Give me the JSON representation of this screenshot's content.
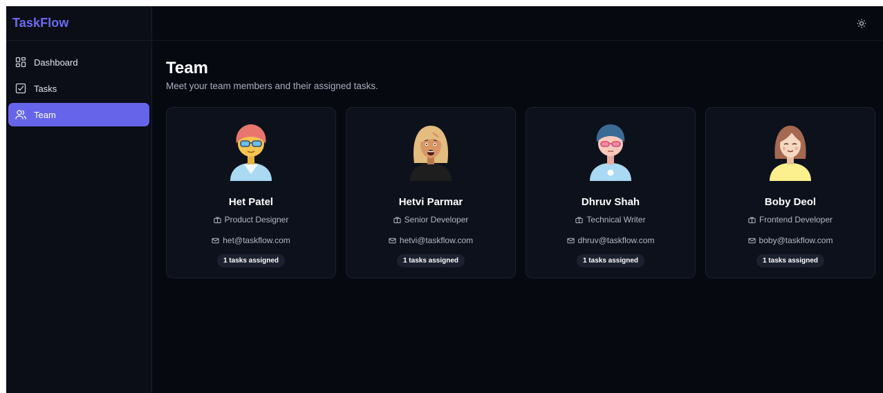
{
  "app": {
    "brand": "TaskFlow",
    "accent": "#6665e9"
  },
  "sidebar": {
    "items": [
      {
        "label": "Dashboard",
        "icon": "layout-grid-icon",
        "active": false
      },
      {
        "label": "Tasks",
        "icon": "check-square-icon",
        "active": false
      },
      {
        "label": "Team",
        "icon": "users-icon",
        "active": true
      }
    ]
  },
  "header": {
    "theme_toggle_icon": "sun-icon"
  },
  "page": {
    "title": "Team",
    "subtitle": "Meet your team members and their assigned tasks."
  },
  "members": [
    {
      "name": "Het Patel",
      "role": "Product Designer",
      "email": "het@taskflow.com",
      "tasks": "1 tasks assigned",
      "avatar": {
        "hair": "#e8766e",
        "skin": "#f5c451",
        "shirt": "#a9d9f3",
        "accessory": "sunglasses"
      }
    },
    {
      "name": "Hetvi Parmar",
      "role": "Senior Developer",
      "email": "hetvi@taskflow.com",
      "tasks": "1 tasks assigned",
      "avatar": {
        "hair": "#e2bd7f",
        "skin": "#d89566",
        "shirt": "#1e1e1e",
        "accessory": "none"
      }
    },
    {
      "name": "Dhruv Shah",
      "role": "Technical Writer",
      "email": "dhruv@taskflow.com",
      "tasks": "1 tasks assigned",
      "avatar": {
        "hair": "#3a6b97",
        "skin": "#f8c8bd",
        "shirt": "#a9d9f3",
        "accessory": "glasses"
      }
    },
    {
      "name": "Boby Deol",
      "role": "Frontend Developer",
      "email": "boby@taskflow.com",
      "tasks": "1 tasks assigned",
      "avatar": {
        "hair": "#a56850",
        "skin": "#f6d8c0",
        "shirt": "#fbf08d",
        "accessory": "none"
      }
    }
  ]
}
